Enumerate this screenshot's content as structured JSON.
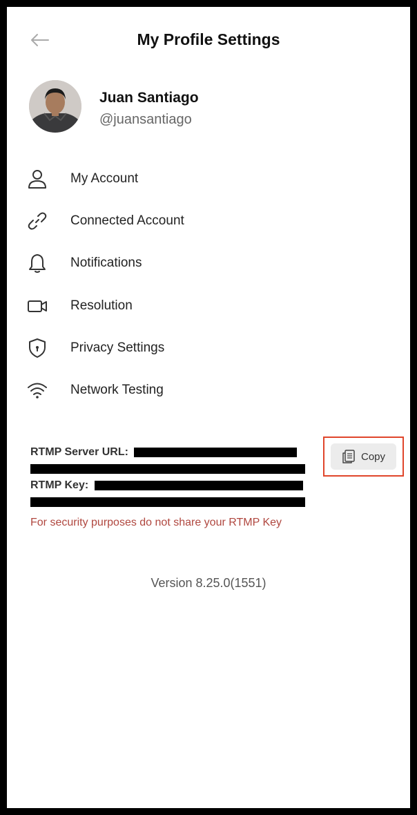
{
  "header": {
    "title": "My Profile Settings",
    "back_icon": "arrow-left-icon"
  },
  "profile": {
    "name": "Juan Santiago",
    "handle": "@juansantiago"
  },
  "menu": {
    "items": [
      {
        "label": "My Account",
        "icon": "user-icon"
      },
      {
        "label": "Connected Account",
        "icon": "link-icon"
      },
      {
        "label": "Notifications",
        "icon": "bell-icon"
      },
      {
        "label": "Resolution",
        "icon": "video-camera-icon"
      },
      {
        "label": "Privacy Settings",
        "icon": "shield-icon"
      },
      {
        "label": "Network Testing",
        "icon": "wifi-icon"
      }
    ]
  },
  "rtmp": {
    "server_url_label": "RTMP Server URL:",
    "key_label": "RTMP Key:",
    "warning": "For security purposes do not share your RTMP Key",
    "copy_label": "Copy"
  },
  "footer": {
    "version": "Version 8.25.0(1551)"
  },
  "colors": {
    "warning": "#b0473f",
    "highlight_border": "#e0452a",
    "copy_button_bg": "#ececec"
  }
}
